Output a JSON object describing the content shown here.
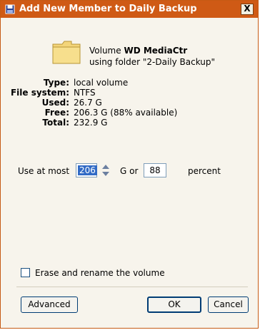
{
  "window": {
    "title": "Add New Member to Daily Backup",
    "close_glyph": "X",
    "accent_color": "#cf5a15"
  },
  "volume": {
    "prefix": "Volume ",
    "name": "WD MediaCtr",
    "folder_text": "using folder \"2-Daily Backup\""
  },
  "info": [
    {
      "label": "Type:",
      "value": "local volume"
    },
    {
      "label": "File system:",
      "value": "NTFS"
    },
    {
      "label": "Used:",
      "value": "26.7 G"
    },
    {
      "label": "Free:",
      "value": "206.3 G (88% available)"
    },
    {
      "label": "Total:",
      "value": "232.9 G"
    }
  ],
  "limit": {
    "use_at_most_label": "Use at most",
    "gigabytes_value": "206",
    "g_or_label": "G or",
    "percent_value": "88",
    "percent_label": "percent"
  },
  "erase": {
    "checked": false,
    "label": "Erase and rename the volume"
  },
  "buttons": {
    "advanced": "Advanced",
    "ok": "OK",
    "cancel": "Cancel"
  }
}
